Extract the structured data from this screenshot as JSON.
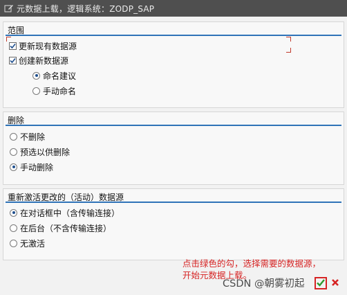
{
  "window": {
    "title": "元数据上载，逻辑系统：ZODP_SAP"
  },
  "scope": {
    "title": "范围",
    "update_existing": {
      "label": "更新现有数据源",
      "checked": true
    },
    "create_new": {
      "label": "创建新数据源",
      "checked": true
    },
    "naming_proposal": {
      "label": "命名建议",
      "selected": true
    },
    "manual_naming": {
      "label": "手动命名",
      "selected": false
    }
  },
  "delete": {
    "title": "删除",
    "options": [
      "不删除",
      "预选以供删除",
      "手动删除"
    ],
    "selected_index": 2
  },
  "reactivate": {
    "title": "重新激活更改的（活动）数据源",
    "options": [
      "在对话框中（含传输连接）",
      "在后台（不含传输连接）",
      "无激活"
    ],
    "selected_index": 0
  },
  "annotation": {
    "line1": "点击绿色的勾，选择需要的数据源，",
    "line2": "开始元数据上载。"
  },
  "watermark": "CSDN @朝雾初起",
  "colors": {
    "accent": "#2f73b8",
    "annotation": "#d62424",
    "titlebar": "#4f4f4f"
  }
}
